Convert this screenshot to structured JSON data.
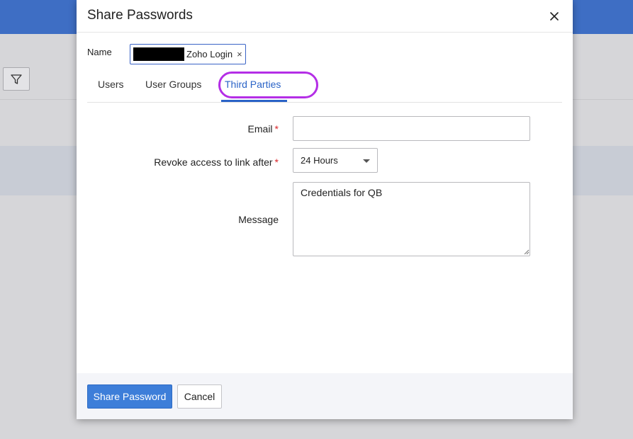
{
  "dialog": {
    "title": "Share Passwords",
    "close_icon": "close-icon"
  },
  "name_field": {
    "label": "Name",
    "chip_text": "Zoho Login",
    "chip_remove": "×"
  },
  "tabs": [
    {
      "label": "Users",
      "active": false
    },
    {
      "label": "User Groups",
      "active": false
    },
    {
      "label": "Third Parties",
      "active": true
    }
  ],
  "form": {
    "email_label": "Email",
    "email_value": "",
    "revoke_label": "Revoke access to link after",
    "revoke_value": "24 Hours",
    "message_label": "Message",
    "message_value": "Credentials for QB",
    "required_mark": "*"
  },
  "footer": {
    "share_label": "Share Password",
    "cancel_label": "Cancel"
  },
  "colors": {
    "accent": "#2a63c7",
    "highlight_ring": "#b42ee6",
    "required": "#d9262b",
    "header_bg": "#3e6ec4"
  },
  "icons": {
    "filter": "filter-icon",
    "dropdown": "chevron-down-icon"
  }
}
